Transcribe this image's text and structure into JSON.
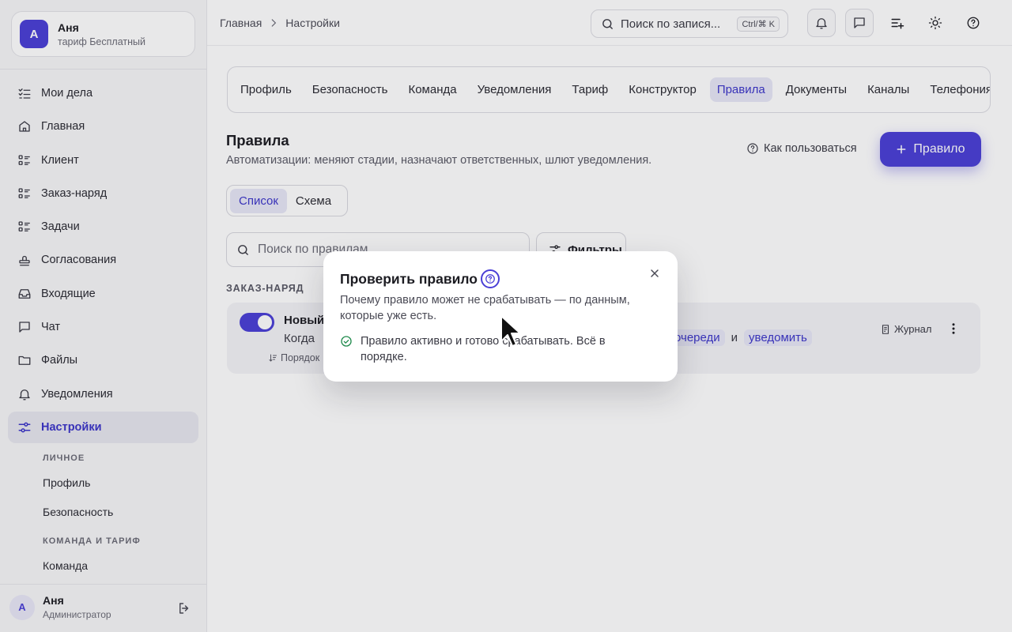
{
  "workspace": {
    "avatar": "А",
    "name": "Аня",
    "plan": "тариф Бесплатный"
  },
  "nav": [
    {
      "label": "Мои дела",
      "icon": "checklist-icon"
    },
    {
      "label": "Главная",
      "icon": "home-icon"
    },
    {
      "label": "Клиент",
      "icon": "list-icon"
    },
    {
      "label": "Заказ-наряд",
      "icon": "list-icon"
    },
    {
      "label": "Задачи",
      "icon": "list-icon"
    },
    {
      "label": "Согласования",
      "icon": "stamp-icon"
    },
    {
      "label": "Входящие",
      "icon": "inbox-icon"
    },
    {
      "label": "Чат",
      "icon": "chat-icon"
    },
    {
      "label": "Файлы",
      "icon": "folder-icon"
    },
    {
      "label": "Уведомления",
      "icon": "bell-icon"
    },
    {
      "label": "Настройки",
      "icon": "settings-sliders-icon",
      "active": true
    }
  ],
  "settings_sub": {
    "personal_head": "ЛИЧНОЕ",
    "profile": "Профиль",
    "security": "Безопасность",
    "team_head": "КОМАНДА И ТАРИФ",
    "team": "Команда"
  },
  "user": {
    "avatar": "А",
    "name": "Аня",
    "role": "Администратор"
  },
  "breadcrumbs": {
    "home": "Главная",
    "current": "Настройки"
  },
  "top_search": {
    "placeholder": "Поиск по запися...",
    "shortcut": "Ctrl/⌘ K"
  },
  "tabs": [
    "Профиль",
    "Безопасность",
    "Команда",
    "Уведомления",
    "Тариф",
    "Конструктор",
    "Правила",
    "Документы",
    "Каналы",
    "Телефония"
  ],
  "active_tab": "Правила",
  "page": {
    "title": "Правила",
    "subtitle": "Автоматизации: меняют стадии, назначают ответственных, шлют уведомления.",
    "howto": "Как пользоваться",
    "add_button": "Правило",
    "view_list": "Список",
    "view_schema": "Схема",
    "search_placeholder": "Поиск по правилам",
    "filters": "Фильтры",
    "group": "ЗАКАЗ-НАРЯД"
  },
  "rule": {
    "name": "Новый",
    "when": "Когда",
    "order": "Порядок",
    "chip_queue": "очереди",
    "conj": "и",
    "chip_notify": "уведомить",
    "journal": "Журнал",
    "enabled": true
  },
  "dialog": {
    "title": "Проверить правило",
    "description": "Почему правило может не срабатывать — по данным, которые уже есть.",
    "status": "Правило активно и готово срабатывать. Всё в порядке."
  },
  "colors": {
    "accent": "#4a3fd6",
    "accent_soft": "#e7e7f7",
    "success": "#1f8a4c"
  }
}
